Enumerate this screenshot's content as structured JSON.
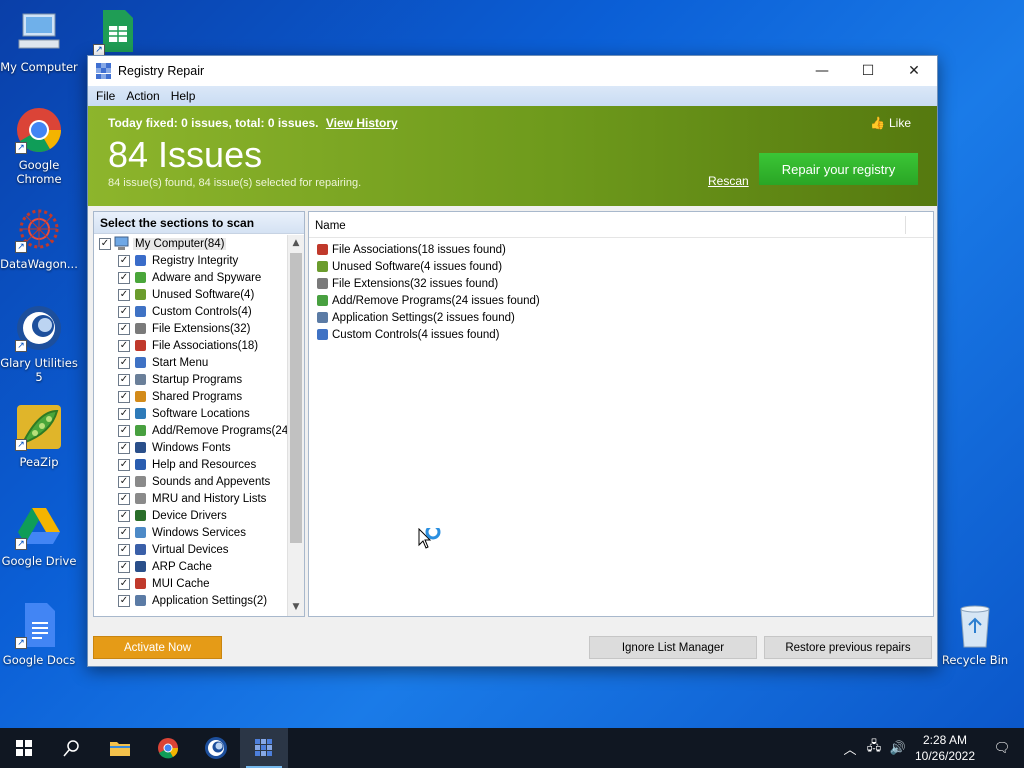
{
  "desktop": {
    "icons": [
      {
        "label": "My Computer"
      },
      {
        "label": "Google Chrome"
      },
      {
        "label": "DataWagon..."
      },
      {
        "label": "Glary Utilities 5"
      },
      {
        "label": "PeaZip"
      },
      {
        "label": "Google Drive"
      },
      {
        "label": "Google Docs"
      },
      {
        "label": "Recycle Bin"
      }
    ]
  },
  "window": {
    "title": "Registry Repair",
    "controls": {
      "minimize": "—",
      "maximize": "☐",
      "close": "✕"
    }
  },
  "menu": {
    "file": "File",
    "action": "Action",
    "help": "Help"
  },
  "banner": {
    "today_text": "Today fixed: 0 issues, total: 0 issues.",
    "view_history": "View History",
    "like": "Like",
    "issue_count": "84 Issues",
    "summary": "84 issue(s) found, 84 issue(s) selected for repairing.",
    "rescan": "Rescan",
    "repair_button": "Repair your registry"
  },
  "left_panel": {
    "header": "Select the sections to scan",
    "root": "My Computer(84)",
    "items": [
      "Registry Integrity",
      "Adware and Spyware",
      "Unused Software(4)",
      "Custom Controls(4)",
      "File Extensions(32)",
      "File Associations(18)",
      "Start Menu",
      "Startup Programs",
      "Shared Programs",
      "Software Locations",
      "Add/Remove Programs(24)",
      "Windows Fonts",
      "Help and Resources",
      "Sounds and Appevents",
      "MRU and History Lists",
      "Device Drivers",
      "Windows Services",
      "Virtual Devices",
      "ARP Cache",
      "MUI Cache",
      "Application Settings(2)"
    ]
  },
  "right_panel": {
    "column_name": "Name",
    "issues": [
      "File Associations(18 issues found)",
      "Unused Software(4 issues found)",
      "File Extensions(32 issues found)",
      "Add/Remove Programs(24 issues found)",
      "Application Settings(2 issues found)",
      "Custom Controls(4 issues found)"
    ]
  },
  "footer": {
    "activate": "Activate Now",
    "ignore_list": "Ignore List Manager",
    "restore": "Restore previous repairs"
  },
  "taskbar": {
    "time": "2:28 AM",
    "date": "10/26/2022"
  }
}
